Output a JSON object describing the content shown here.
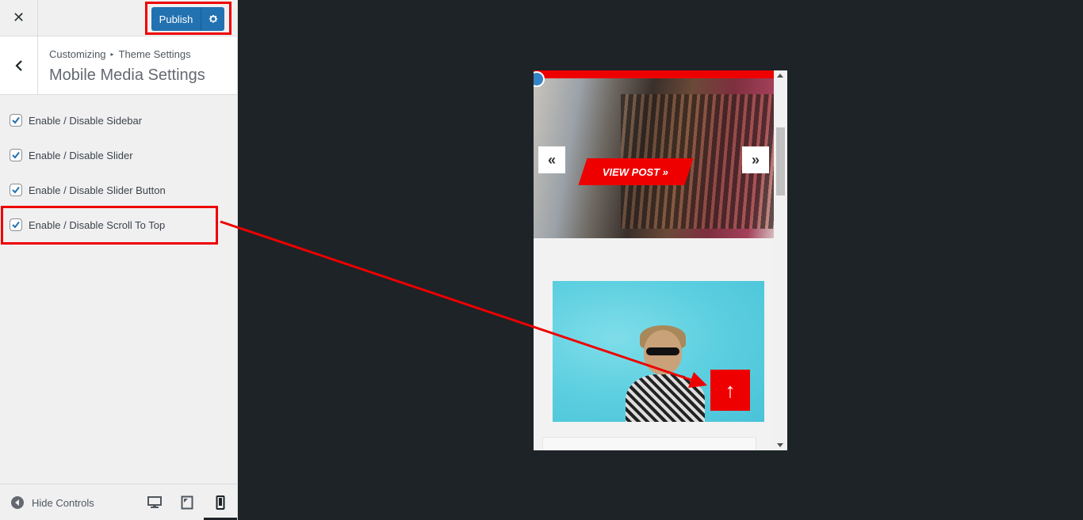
{
  "topbar": {
    "close_label": "✕",
    "publish_label": "Publish"
  },
  "header": {
    "breadcrumb_root": "Customizing",
    "breadcrumb_section": "Theme Settings",
    "title": "Mobile Media Settings"
  },
  "options": [
    {
      "label": "Enable / Disable Sidebar",
      "checked": true
    },
    {
      "label": "Enable / Disable Slider",
      "checked": true
    },
    {
      "label": "Enable / Disable Slider Button",
      "checked": true
    },
    {
      "label": "Enable / Disable Scroll To Top",
      "checked": true
    }
  ],
  "footer": {
    "hide_controls_label": "Hide Controls"
  },
  "preview": {
    "slider_prev": "«",
    "slider_next": "»",
    "view_post_label": "VIEW POST »",
    "scroll_top_glyph": "↑"
  },
  "colors": {
    "accent": "#2271b1",
    "highlight": "#ee0000",
    "background": "#1d2327"
  }
}
